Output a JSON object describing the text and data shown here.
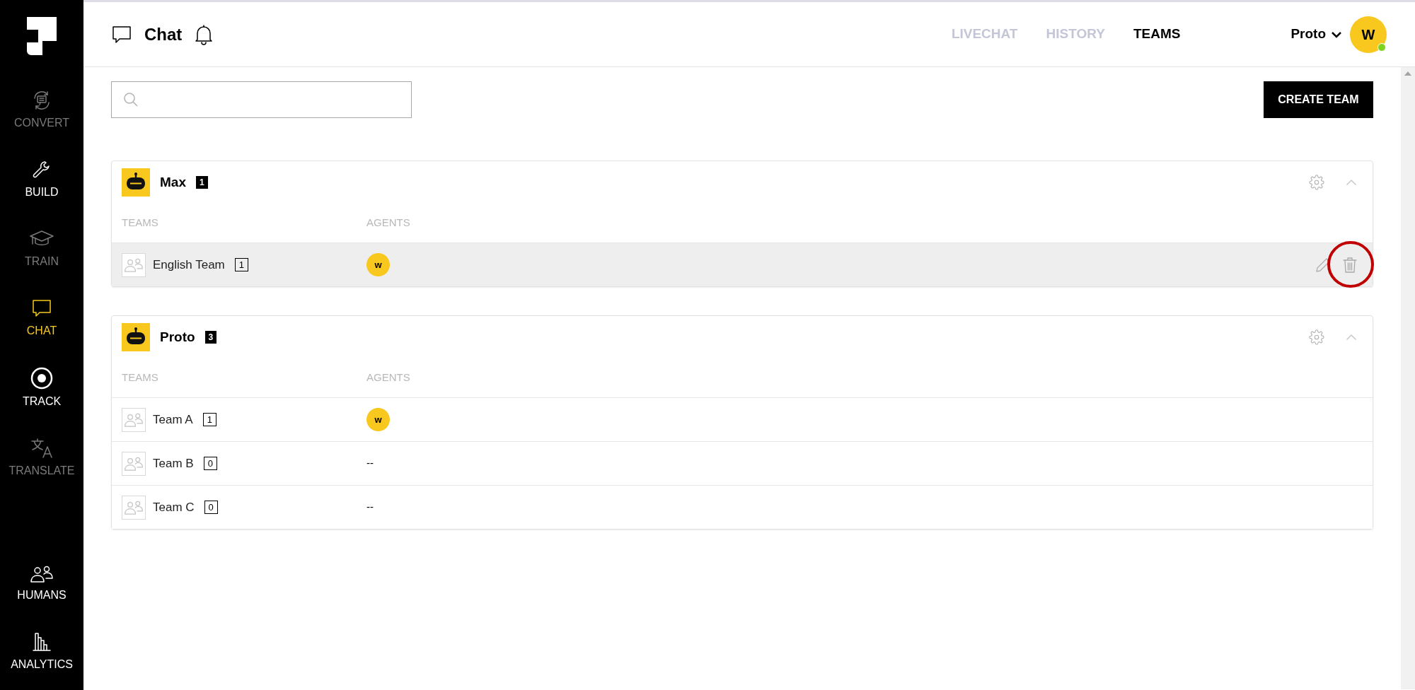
{
  "sidebar": {
    "items": [
      {
        "label": "CONVERT",
        "selected": false,
        "disabled": true
      },
      {
        "label": "BUILD",
        "selected": false,
        "disabled": false
      },
      {
        "label": "TRAIN",
        "selected": false,
        "disabled": true
      },
      {
        "label": "CHAT",
        "selected": true,
        "disabled": false
      },
      {
        "label": "TRACK",
        "selected": false,
        "disabled": false
      },
      {
        "label": "TRANSLATE",
        "selected": false,
        "disabled": true
      }
    ],
    "bottom_items": [
      {
        "label": "HUMANS",
        "selected": false,
        "disabled": false
      },
      {
        "label": "ANALYTICS",
        "selected": false,
        "disabled": false
      }
    ]
  },
  "header": {
    "title": "Chat",
    "tabs": [
      {
        "label": "LIVECHAT",
        "selected": false
      },
      {
        "label": "HISTORY",
        "selected": false
      },
      {
        "label": "TEAMS",
        "selected": true
      }
    ],
    "account": "Proto",
    "avatar": {
      "initial": "W",
      "online": true
    }
  },
  "toolbar": {
    "create_button": "CREATE TEAM"
  },
  "groups": [
    {
      "name": "Max",
      "count": "1",
      "columns": [
        "TEAMS",
        "AGENTS"
      ],
      "rows": [
        {
          "team": "English Team",
          "count": "1",
          "agent": "w",
          "hovered": true,
          "delete_highlighted": true
        }
      ]
    },
    {
      "name": "Proto",
      "count": "3",
      "columns": [
        "TEAMS",
        "AGENTS"
      ],
      "rows": [
        {
          "team": "Team A",
          "count": "1",
          "agent": "w",
          "hovered": false,
          "delete_highlighted": false
        },
        {
          "team": "Team B",
          "count": "0",
          "agent": "--",
          "hovered": false,
          "delete_highlighted": false
        },
        {
          "team": "Team C",
          "count": "0",
          "agent": "--",
          "hovered": false,
          "delete_highlighted": false
        }
      ]
    }
  ]
}
